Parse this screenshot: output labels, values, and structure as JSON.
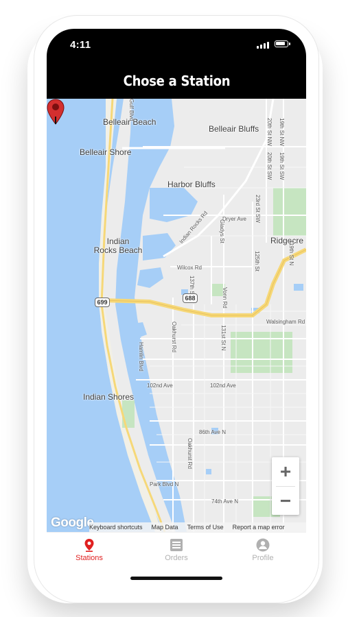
{
  "status_bar": {
    "time": "4:11",
    "battery_level": 0.85
  },
  "header": {
    "title": "Chose a Station"
  },
  "map": {
    "places": {
      "belleair_beach": "Belleair Beach",
      "belleair_bluffs": "Belleair Bluffs",
      "belleair_shore": "Belleair Shore",
      "harbor_bluffs": "Harbor Bluffs",
      "indian_rocks_beach_line1": "Indian",
      "indian_rocks_beach_line2": "Rocks Beach",
      "ridgecrest": "Ridgecre",
      "indian_shores": "Indian Shores"
    },
    "streets": {
      "walsingham": "Walsingham Rd",
      "willcox": "Wilcox Rd",
      "dryer": "Dryer Ave",
      "ave_102nd_w": "102nd Ave",
      "ave_102nd_e": "102nd Ave",
      "ave_86th": "86th Ave N",
      "park_blvd": "Park Blvd N",
      "ave_74th": "74th Ave N",
      "oakhurst_n": "Oakhurst Rd",
      "oakhurst_s": "Oakhurst Rd",
      "hamlin": "Hamlin Blvd",
      "st_137th": "137th St",
      "vonn": "Vonn Rd",
      "st_131st": "131st St N",
      "st_125th": "125th St",
      "st_119th": "119th St N",
      "st_23rd": "23rd St SW",
      "st_20th_nw": "20th St NW",
      "st_20th_sw": "20th St SW",
      "st_19th_nw": "19th St NW",
      "st_19th_sw": "19th St SW",
      "indian_rocks_rd": "Indian Rocks Rd",
      "gladys": "Gladys St",
      "gulf_blvd": "Gulf Blvd"
    },
    "route_shields": {
      "r688": "688",
      "r699": "699"
    },
    "zoom": {
      "in_symbol": "+",
      "out_symbol": "−"
    },
    "google_logo": "Google",
    "attribution": {
      "keyboard": "Keyboard shortcuts",
      "map_data": "Map Data",
      "terms": "Terms of Use",
      "report": "Report a map error"
    },
    "colors": {
      "water": "#a6cef7",
      "land": "#ececec",
      "park": "#c6e5c1",
      "highway": "#f6d878",
      "pin": "#d32f2f"
    }
  },
  "tabbar": {
    "active_color": "#e02020",
    "inactive_color": "#b0b0b0",
    "tabs": [
      {
        "label": "Stations",
        "icon": "map-pin-icon",
        "active": true
      },
      {
        "label": "Orders",
        "icon": "list-icon",
        "active": false
      },
      {
        "label": "Profile",
        "icon": "person-icon",
        "active": false
      }
    ]
  }
}
